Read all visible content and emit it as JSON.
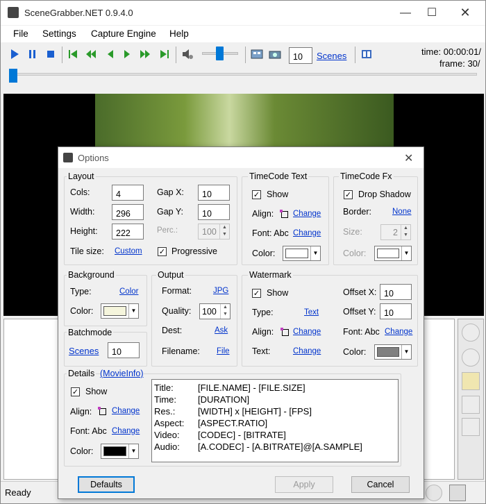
{
  "window": {
    "title": "SceneGrabber.NET 0.9.4.0"
  },
  "menu": [
    "File",
    "Settings",
    "Capture Engine",
    "Help"
  ],
  "toolbar": {
    "scenes_count": "10",
    "scenes_link": "Scenes",
    "time_label": "time: 00:00:01/",
    "frame_label": "frame: 30/"
  },
  "status": {
    "text": "Ready"
  },
  "dialog": {
    "title": "Options",
    "layout": {
      "group": "Layout",
      "cols_label": "Cols:",
      "cols": "4",
      "width_label": "Width:",
      "width": "296",
      "height_label": "Height:",
      "height": "222",
      "tilesize_label": "Tile size:",
      "tilesize_link": "Custom",
      "gapx_label": "Gap X:",
      "gapx": "10",
      "gapy_label": "Gap Y:",
      "gapy": "10",
      "perc_label": "Perc.:",
      "perc": "100",
      "progressive_label": "Progressive"
    },
    "timecode_text": {
      "group": "TimeCode Text",
      "show_label": "Show",
      "align_label": "Align:",
      "align_link": "Change",
      "font_label": "Font: Abc",
      "font_link": "Change",
      "color_label": "Color:",
      "color": "#ffffff"
    },
    "timecode_fx": {
      "group": "TimeCode Fx",
      "dropshadow_label": "Drop Shadow",
      "border_label": "Border:",
      "border_link": "None",
      "size_label": "Size:",
      "size": "2",
      "color_label": "Color:",
      "color": "#ffffff"
    },
    "background": {
      "group": "Background",
      "type_label": "Type:",
      "type_link": "Color",
      "color_label": "Color:",
      "color": "#f5f5dc"
    },
    "output": {
      "group": "Output",
      "format_label": "Format:",
      "format_link": "JPG",
      "quality_label": "Quality:",
      "quality": "100",
      "dest_label": "Dest:",
      "dest_link": "Ask",
      "filename_label": "Filename:",
      "filename_link": "File"
    },
    "watermark": {
      "group": "Watermark",
      "show_label": "Show",
      "type_label": "Type:",
      "type_link": "Text",
      "align_label": "Align:",
      "align_link": "Change",
      "text_label": "Text:",
      "text_link": "Change",
      "offsetx_label": "Offset X:",
      "offsetx": "10",
      "offsety_label": "Offset Y:",
      "offsety": "10",
      "font_label": "Font: Abc",
      "font_link": "Change",
      "color_label": "Color:",
      "color": "#808080"
    },
    "batchmode": {
      "group": "Batchmode",
      "scenes_link": "Scenes",
      "scenes": "10"
    },
    "details": {
      "group": "Details",
      "movieinfo_link": "(MovieInfo)",
      "show_label": "Show",
      "align_label": "Align:",
      "align_link": "Change",
      "font_label": "Font: Abc",
      "font_link": "Change",
      "color_label": "Color:",
      "color": "#000000",
      "rows": [
        {
          "k": "Title:",
          "v": "[FILE.NAME] - [FILE.SIZE]"
        },
        {
          "k": "Time:",
          "v": "[DURATION]"
        },
        {
          "k": "Res.:",
          "v": "[WIDTH] x [HEIGHT] - [FPS]"
        },
        {
          "k": "Aspect:",
          "v": "[ASPECT.RATIO]"
        },
        {
          "k": "Video:",
          "v": "[CODEC] - [BITRATE]"
        },
        {
          "k": "Audio:",
          "v": "[A.CODEC] - [A.BITRATE]@[A.SAMPLE]"
        }
      ]
    },
    "buttons": {
      "defaults": "Defaults",
      "apply": "Apply",
      "cancel": "Cancel"
    }
  },
  "icons": {
    "play": "play-icon",
    "pause": "pause-icon",
    "stop": "stop-icon",
    "first": "skip-first-icon",
    "rewind": "rewind-icon",
    "prev": "prev-frame-icon",
    "next": "next-frame-icon",
    "ffwd": "fast-forward-icon",
    "last": "skip-last-icon"
  }
}
